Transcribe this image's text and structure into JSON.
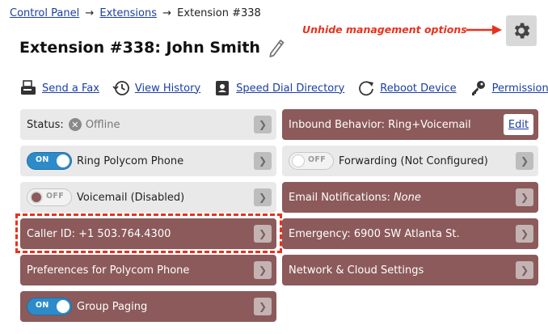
{
  "breadcrumb": {
    "items": [
      "Control Panel",
      "Extensions"
    ],
    "separator": "→",
    "current": "Extension #338"
  },
  "annotation": {
    "text": "Unhide management options",
    "color": "#e8321c"
  },
  "header": {
    "title": "Extension #338: John Smith"
  },
  "actions": [
    {
      "label": "Send a Fax",
      "icon": "fax-icon"
    },
    {
      "label": "View History",
      "icon": "history-icon"
    },
    {
      "label": "Speed Dial Directory",
      "icon": "directory-icon"
    },
    {
      "label": "Reboot Device",
      "icon": "reboot-icon"
    },
    {
      "label": "Permissions",
      "icon": "key-icon"
    }
  ],
  "tiles": {
    "status": {
      "label": "Status:",
      "value": "Offline"
    },
    "ring_polycom": {
      "label": "Ring Polycom Phone",
      "toggle": "ON"
    },
    "voicemail": {
      "label": "Voicemail (Disabled)",
      "toggle": "OFF"
    },
    "caller_id": {
      "label": "Caller ID: +1 503.764.4300"
    },
    "preferences": {
      "label": "Preferences for Polycom Phone"
    },
    "group_paging": {
      "label": "Group Paging",
      "toggle": "ON"
    },
    "inbound": {
      "label": "Inbound Behavior: Ring+Voicemail",
      "edit": "Edit"
    },
    "forwarding": {
      "label": "Forwarding (Not Configured)",
      "toggle": "OFF"
    },
    "email": {
      "label": "Email Notifications:",
      "value": "None"
    },
    "emergency": {
      "label": "Emergency: 6900 SW Atlanta St."
    },
    "network": {
      "label": "Network & Cloud Settings"
    }
  },
  "chevron": "❯",
  "colors": {
    "accent_dark": "#8c5a5a",
    "link": "#1a3fa0",
    "toggle_on": "#2e8bc9",
    "tile_light": "#e9e9e9"
  }
}
